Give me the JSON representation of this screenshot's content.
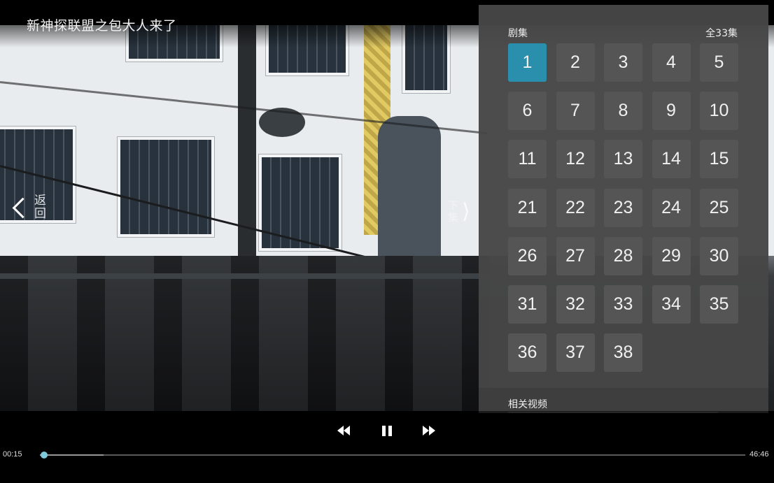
{
  "title": "新神探联盟之包大人来了",
  "back_nav": {
    "label": "返回"
  },
  "next_nav": {
    "label": "下集"
  },
  "episode_panel": {
    "section_label": "剧集",
    "total_label": "全33集",
    "selected": "1",
    "episodes": [
      "1",
      "2",
      "3",
      "4",
      "5",
      "6",
      "7",
      "8",
      "9",
      "10",
      "11",
      "12",
      "13",
      "14",
      "15",
      "21",
      "22",
      "23",
      "24",
      "25",
      "26",
      "27",
      "28",
      "29",
      "30",
      "31",
      "32",
      "33",
      "34",
      "35",
      "36",
      "37",
      "38"
    ]
  },
  "related": {
    "label": "相关视频"
  },
  "player": {
    "current_time": "00:15",
    "total_time": "46:46",
    "progress_fraction": 0.005,
    "buffer_fraction": 0.09,
    "accent_color": "#2a8fac"
  }
}
